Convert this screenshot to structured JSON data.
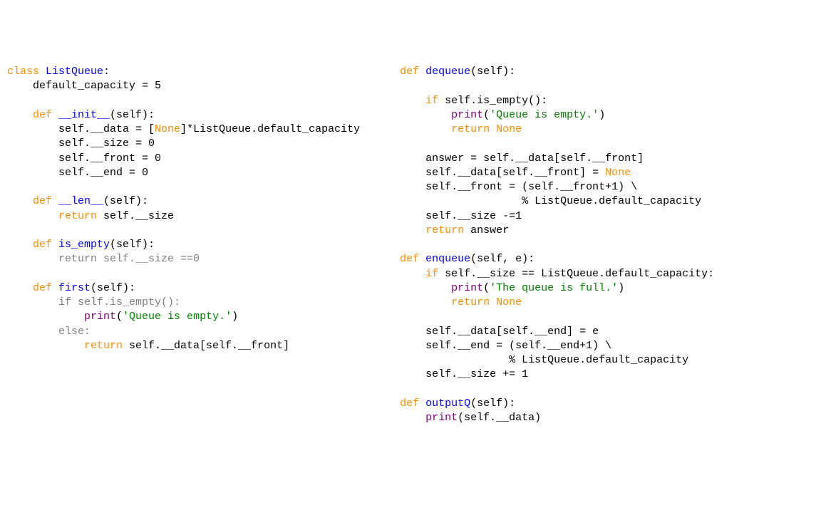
{
  "left": {
    "l1a": "class",
    "l1b": "ListQueue",
    "l1c": ":",
    "l2": "    default_capacity = 5",
    "l3a": "    def",
    "l3b": " __init__",
    "l3c": "(self):",
    "l4a": "        self.__data = [",
    "l4b": "None",
    "l4c": "]*ListQueue.default_capacity",
    "l5": "        self.__size = 0",
    "l6": "        self.__front = 0",
    "l7": "        self.__end = 0",
    "l8a": "    def",
    "l8b": " __len__",
    "l8c": "(self):",
    "l9a": "        return",
    "l9b": " self.__size",
    "l10a": "    def",
    "l10b": " is_empty",
    "l10c": "(self):",
    "l11a": "        return",
    "l11b": " self.__size ==0",
    "l12a": "    def",
    "l12b": " first",
    "l12c": "(self):",
    "l13a": "        if",
    "l13b": " self.is_empty():",
    "l14a": "            print",
    "l14b": "(",
    "l14c": "'Queue is empty.'",
    "l14d": ")",
    "l15a": "        else",
    "l15b": ":",
    "l16a": "            return",
    "l16b": " self.__data[self.__front]"
  },
  "right": {
    "r1a": "    def",
    "r1b": " dequeue",
    "r1c": "(self):",
    "r2a": "        if",
    "r2b": " self.is_empty():",
    "r3a": "            print",
    "r3b": "(",
    "r3c": "'Queue is empty.'",
    "r3d": ")",
    "r4a": "            return",
    "r4b": " None",
    "r5": "        answer = self.__data[self.__front]",
    "r6a": "        self.__data[self.__front] = ",
    "r6b": "None",
    "r7": "        self.__front = (self.__front+1) \\",
    "r8": "                       % ListQueue.default_capacity",
    "r9": "        self.__size -=1",
    "r10a": "        return",
    "r10b": " answer",
    "r11a": "    def",
    "r11b": " enqueue",
    "r11c": "(self, e):",
    "r12a": "        if",
    "r12b": " self.__size == ListQueue.default_capacity:",
    "r13a": "            print",
    "r13b": "(",
    "r13c": "'The queue is full.'",
    "r13d": ")",
    "r14a": "            return",
    "r14b": " None",
    "r15": "        self.__data[self.__end] = e",
    "r16": "        self.__end = (self.__end+1) \\",
    "r17": "                     % ListQueue.default_capacity",
    "r18": "        self.__size += 1",
    "r19a": "    def",
    "r19b": " outputQ",
    "r19c": "(self):",
    "r20a": "        print",
    "r20b": "(self.__data)"
  }
}
